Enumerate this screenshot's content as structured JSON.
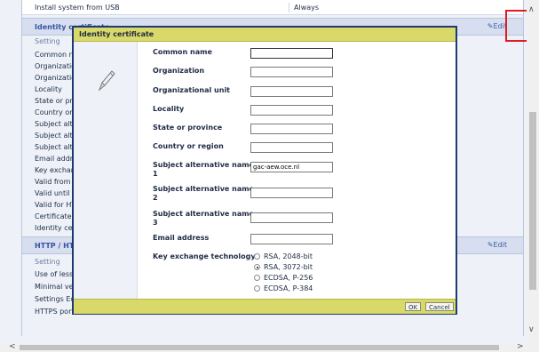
{
  "top_row": {
    "label": "Install system from USB",
    "value": "Always"
  },
  "identity_section": {
    "title": "Identity certificate",
    "edit_label": "Edit",
    "rows": [
      "Setting",
      "Common na",
      "Organization",
      "Organization",
      "Locality",
      "State or pro",
      "Country or",
      "Subject alte",
      "Subject alte",
      "Subject alte",
      "Email addre",
      "Key exchan",
      "Valid from",
      "Valid until",
      "Valid for HT",
      "Certificate s",
      "Identity cer"
    ]
  },
  "http_section": {
    "title": "HTTP / HT",
    "edit_label": "Edit",
    "rows": [
      "Setting",
      "Use of less",
      "Minimal ver",
      "Settings Ed",
      "HTTPS port"
    ]
  },
  "modal": {
    "title": "Identity certificate",
    "fields": [
      {
        "label": "Common name",
        "value": ""
      },
      {
        "label": "Organization",
        "value": ""
      },
      {
        "label": "Organizational unit",
        "value": ""
      },
      {
        "label": "Locality",
        "value": ""
      },
      {
        "label": "State or province",
        "value": ""
      },
      {
        "label": "Country or region",
        "value": ""
      },
      {
        "label": "Subject alternative name",
        "label2": "1",
        "value": "gac-aew.oce.nl"
      },
      {
        "label": "Subject alternative name",
        "label2": "2",
        "value": ""
      },
      {
        "label": "Subject alternative name",
        "label2": "3",
        "value": ""
      },
      {
        "label": "Email address",
        "value": ""
      }
    ],
    "key_exchange": {
      "label": "Key exchange technology",
      "options": [
        "RSA, 2048-bit",
        "RSA, 3072-bit",
        "ECDSA, P-256",
        "ECDSA, P-384"
      ],
      "selected": "RSA, 3072-bit"
    },
    "ok_label": "OK",
    "cancel_label": "Cancel"
  },
  "icons": {
    "edit": "pencil-icon",
    "modal_icon": "pencil-icon"
  }
}
